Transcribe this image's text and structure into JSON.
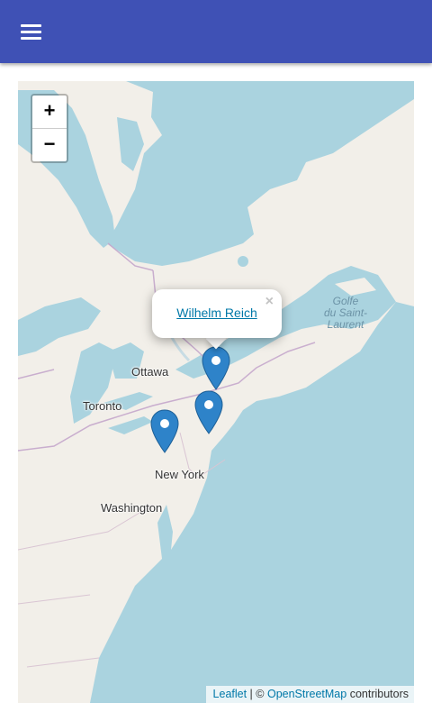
{
  "header": {
    "menu_icon": "hamburger-menu-icon",
    "color": "#3f51b5"
  },
  "map": {
    "zoom_in_label": "+",
    "zoom_out_label": "−",
    "labels": {
      "ottawa": "Ottawa",
      "toronto": "Toronto",
      "new_york": "New York",
      "washington": "Washington",
      "gulf_line1": "Golfe",
      "gulf_line2": "du Saint-",
      "gulf_line3": "Laurent"
    },
    "popup": {
      "link_text": "Wilhelm Reich",
      "close_symbol": "×"
    },
    "attribution": {
      "leaflet": "Leaflet",
      "separator": " | © ",
      "osm": "OpenStreetMap",
      "suffix": " contributors"
    },
    "colors": {
      "water": "#aad3df",
      "land": "#f2efe9",
      "marker": "#2e83c9"
    }
  }
}
